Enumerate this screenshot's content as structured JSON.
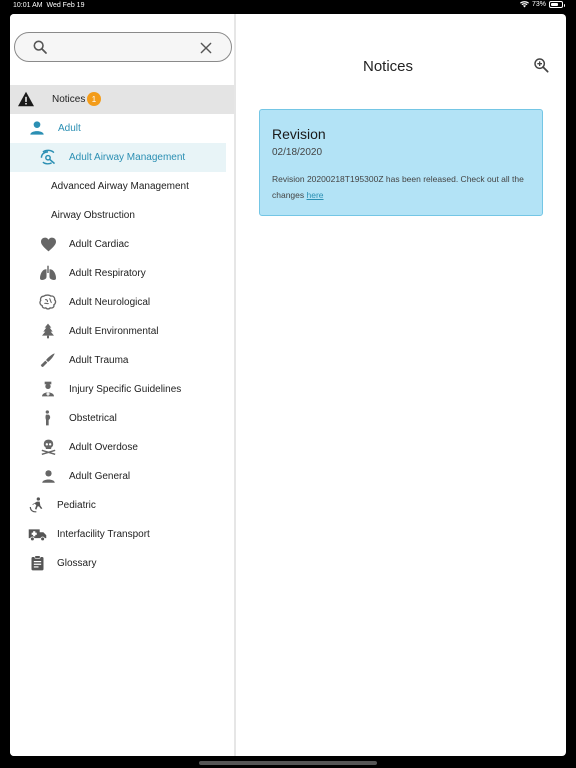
{
  "status_bar": {
    "time": "10:01 AM",
    "date": "Wed Feb 19",
    "battery": "73%",
    "battery_level": 0.73
  },
  "search": {
    "value": "",
    "placeholder": ""
  },
  "nav": {
    "notices": {
      "label": "Notices",
      "badge": "1"
    },
    "adult": "Adult",
    "adult_airway_management": "Adult Airway Management",
    "advanced_airway_management": "Advanced Airway Management",
    "airway_obstruction": "Airway Obstruction",
    "adult_cardiac": "Adult Cardiac",
    "adult_respiratory": "Adult Respiratory",
    "adult_neurological": "Adult Neurological",
    "adult_environmental": "Adult Environmental",
    "adult_trauma": "Adult Trauma",
    "injury_specific_guidelines": "Injury Specific Guidelines",
    "obstetrical": "Obstetrical",
    "adult_overdose": "Adult Overdose",
    "adult_general": "Adult General",
    "pediatric": "Pediatric",
    "interfacility_transport": "Interfacility Transport",
    "glossary": "Glossary"
  },
  "main": {
    "title": "Notices",
    "notice": {
      "title": "Revision",
      "date": "02/18/2020",
      "body": "Revision 20200218T195300Z has been released. Check out all the changes",
      "link": "here"
    }
  },
  "colors": {
    "accent": "#2b8fb3",
    "badge": "#f39c1a",
    "card_bg": "#b3e3f6",
    "card_border": "#74c6e5"
  },
  "icons": {
    "notices": "warning-icon",
    "adult": "person-icon",
    "adult_airway_management": "airway-icon",
    "adult_cardiac": "heart-icon",
    "adult_respiratory": "lungs-icon",
    "adult_neurological": "brain-icon",
    "adult_environmental": "tree-icon",
    "adult_trauma": "knife-icon",
    "injury_specific_guidelines": "medic-icon",
    "obstetrical": "pregnant-icon",
    "adult_overdose": "skull-icon",
    "adult_general": "person-icon",
    "pediatric": "child-icon",
    "interfacility_transport": "ambulance-icon",
    "glossary": "clipboard-icon"
  }
}
